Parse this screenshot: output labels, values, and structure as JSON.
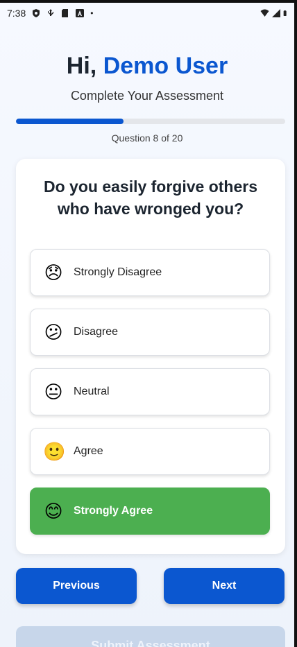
{
  "status_bar": {
    "time": "7:38",
    "dot": "•"
  },
  "header": {
    "greeting": "Hi,",
    "user_name": "Demo User",
    "subtitle": "Complete Your Assessment"
  },
  "progress": {
    "fraction": 0.4,
    "label": "Question 8 of 20"
  },
  "question": {
    "text": "Do you easily forgive others who have wronged you?"
  },
  "options": [
    {
      "label": "Strongly Disagree",
      "emoji": "😞",
      "selected": false
    },
    {
      "label": "Disagree",
      "emoji": "😕",
      "selected": false
    },
    {
      "label": "Neutral",
      "emoji": "😐",
      "selected": false
    },
    {
      "label": "Agree",
      "emoji": "🙂",
      "selected": false
    },
    {
      "label": "Strongly Agree",
      "emoji": "😊",
      "selected": true
    }
  ],
  "nav": {
    "previous_label": "Previous",
    "next_label": "Next",
    "submit_label": "Submit Assessment"
  },
  "colors": {
    "accent": "#0b57d0",
    "selected": "#4caf50",
    "submit_disabled": "#c7d6ea"
  },
  "icons": [
    "shield-icon",
    "usb-icon",
    "sd-card-icon",
    "a-box-icon",
    "wifi-icon",
    "signal-icon",
    "battery-icon"
  ]
}
